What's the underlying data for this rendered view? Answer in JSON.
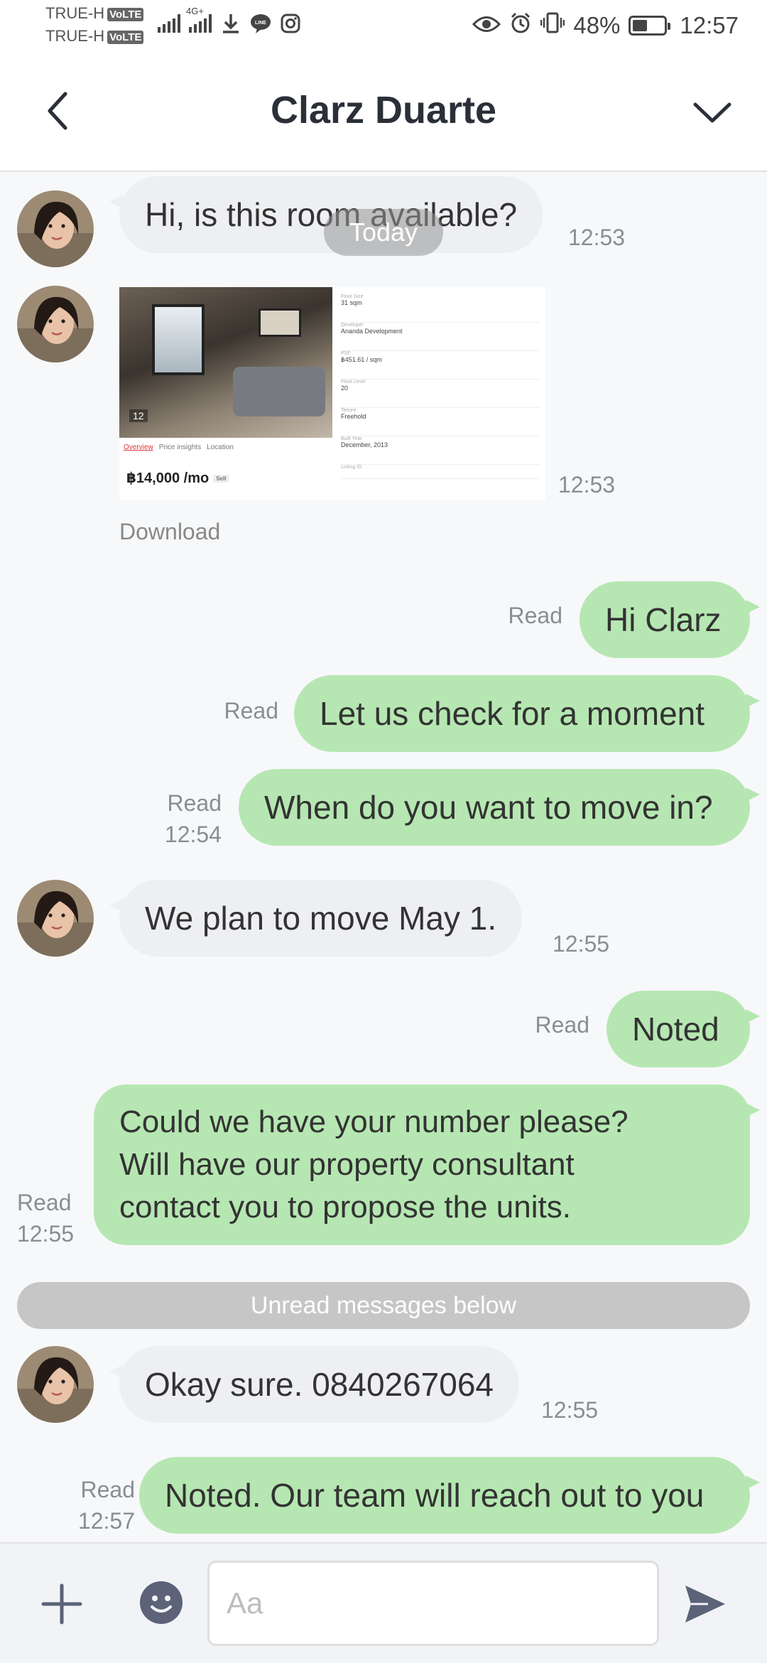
{
  "status_bar": {
    "carrier_1": "TRUE-H",
    "carrier_2": "TRUE-H",
    "volte": "VoLTE",
    "net_label": "4G+",
    "battery_percent": "48%",
    "battery_level": 0.48,
    "time": "12:57"
  },
  "header": {
    "title": "Clarz Duarte"
  },
  "chat": {
    "date_separator": "Today",
    "download_label": "Download",
    "unread_label": "Unread messages below",
    "listing": {
      "price": "฿14,000 /mo",
      "price_tag": "Sell",
      "photo_count": "12",
      "tabs": [
        "Overview",
        "Price insights",
        "Location"
      ],
      "details": [
        {
          "k": "Floor Size",
          "v": "31 sqm"
        },
        {
          "k": "Developer",
          "v": "Ananda Development"
        },
        {
          "k": "PSF",
          "v": "฿451.61 / sqm"
        },
        {
          "k": "Floor Level",
          "v": "20"
        },
        {
          "k": "Tenure",
          "v": "Freehold"
        },
        {
          "k": "Built Year",
          "v": "December, 2013"
        },
        {
          "k": "Listing ID",
          "v": ""
        }
      ]
    },
    "messages": [
      {
        "direction": "in",
        "text": "Hi, is this room available?",
        "time": "12:53"
      },
      {
        "direction": "in",
        "type": "image",
        "time": "12:53"
      },
      {
        "direction": "out",
        "text": "Hi Clarz",
        "status": "Read"
      },
      {
        "direction": "out",
        "text": "Let us check for a moment",
        "status": "Read"
      },
      {
        "direction": "out",
        "text": "When do you want to move in?",
        "status": "Read",
        "time": "12:54"
      },
      {
        "direction": "in",
        "text": "We plan to move May 1.",
        "time": "12:55"
      },
      {
        "direction": "out",
        "text": "Noted",
        "status": "Read"
      },
      {
        "direction": "out",
        "lines": [
          "Could we have your number please?",
          "Will have our property consultant",
          "contact you to propose the units."
        ],
        "status": "Read",
        "time": "12:55"
      },
      {
        "direction": "in",
        "text": "Okay sure. 0840267064",
        "time": "12:55"
      },
      {
        "direction": "out",
        "text": "Noted. Our team will reach out to you",
        "status": "Read",
        "time": "12:57"
      }
    ]
  },
  "input_bar": {
    "placeholder": "Aa"
  },
  "colors": {
    "outgoing_bubble": "#b6e7b2",
    "incoming_bubble": "#eeeff2",
    "icon_color": "#5c6378"
  }
}
